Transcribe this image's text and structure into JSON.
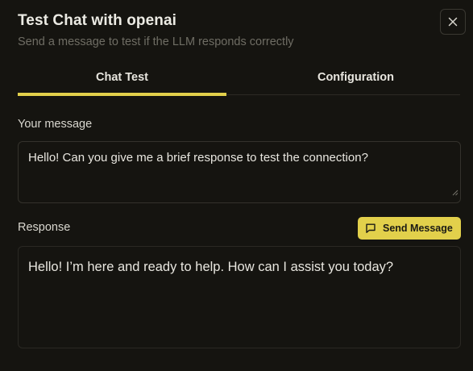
{
  "dialog": {
    "title": "Test Chat with openai",
    "subtitle": "Send a message to test if the LLM responds correctly",
    "close_icon": "close-icon"
  },
  "tabs": [
    {
      "label": "Chat Test",
      "active": true
    },
    {
      "label": "Configuration",
      "active": false
    }
  ],
  "message": {
    "label": "Your message",
    "value": "Hello! Can you give me a brief response to test the connection?"
  },
  "response": {
    "label": "Response",
    "value": "Hello! I’m here and ready to help. How can I assist you today?"
  },
  "send_button": {
    "label": "Send Message",
    "icon": "message-square-icon"
  },
  "colors": {
    "background": "#151410",
    "accent": "#e2d04b",
    "text": "#e8e6df",
    "muted": "#6f6d64",
    "border": "#34322c"
  }
}
